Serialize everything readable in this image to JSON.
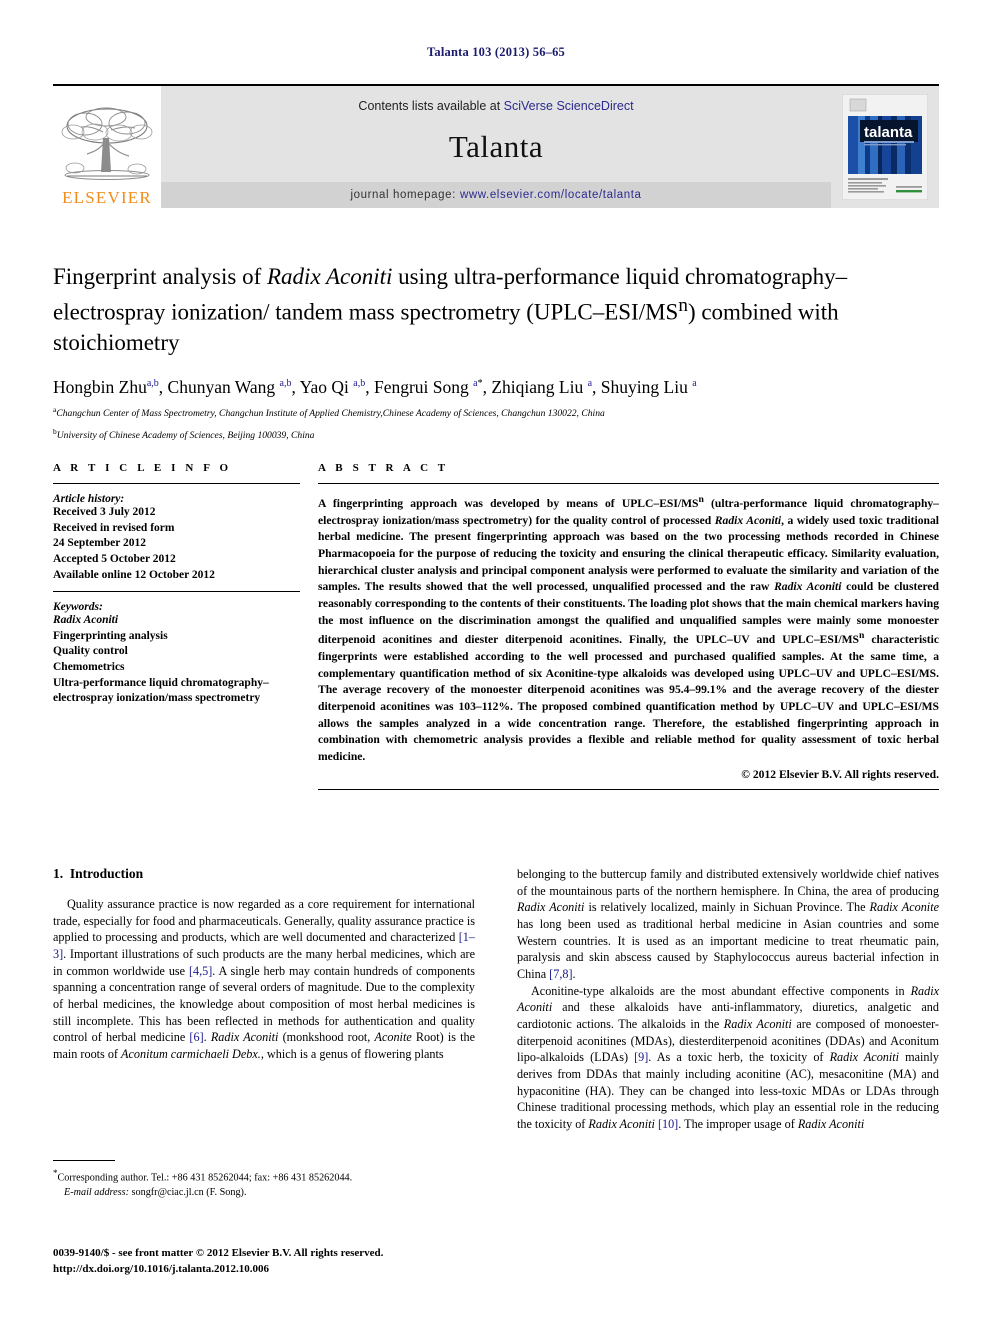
{
  "running_head": "Talanta 103 (2013) 56–65",
  "masthead": {
    "contents_prefix": "Contents lists available at ",
    "contents_link": "SciVerse ScienceDirect",
    "journal_name": "Talanta",
    "homepage_label": "journal homepage:",
    "homepage_link": "www.elsevier.com/locate/talanta",
    "publisher_logo_text": "ELSEVIER",
    "cover_title": "talanta",
    "cover_subtitle": "the international journal of pure and applied analytical chemistry",
    "link_color": "#2b2b8f",
    "brand_color": "#F08C1A",
    "band_color": "#e3e3e3"
  },
  "article": {
    "title_line1_a": "Fingerprint analysis of ",
    "title_line1_i": "Radix Aconiti",
    "title_line1_b": " using ultra-performance liquid",
    "title_line2": "chromatography–electrospray ionization/ tandem mass spectrometry",
    "title_line3_a": "(UPLC–ESI/MS",
    "title_line3_sup": "n",
    "title_line3_b": ") combined with stoichiometry",
    "authors": [
      {
        "name": "Hongbin Zhu",
        "sup": "a,b",
        "sep": ", "
      },
      {
        "name": "Chunyan Wang ",
        "sup": "a,b",
        "sep": ", "
      },
      {
        "name": "Yao Qi ",
        "sup": "a,b",
        "sep": ", "
      },
      {
        "name": "Fengrui Song ",
        "sup": "a",
        "star": "*",
        "sep": ", "
      },
      {
        "name": "Zhiqiang Liu ",
        "sup": "a",
        "sep": ", "
      },
      {
        "name": "Shuying Liu ",
        "sup": "a",
        "sep": ""
      }
    ],
    "affiliations": [
      {
        "marker": "a",
        "text": "Changchun Center of Mass Spectrometry, Changchun Institute of Applied Chemistry,Chinese Academy of Sciences, Changchun 130022, China"
      },
      {
        "marker": "b",
        "text": "University of Chinese Academy of Sciences, Beijing 100039, China"
      }
    ]
  },
  "article_info": {
    "heading": "A R T I C L E  I N F O",
    "history_title": "Article history:",
    "history_lines": [
      "Received 3 July 2012",
      "Received in revised form",
      "24 September 2012",
      "Accepted 5 October 2012",
      "Available online 12 October 2012"
    ],
    "keywords_title": "Keywords:",
    "keywords": [
      "Radix Aconiti",
      "Fingerprinting analysis",
      "Quality control",
      "Chemometrics",
      "Ultra-performance liquid chromatography–",
      "electrospray ionization/mass spectrometry"
    ]
  },
  "abstract": {
    "heading": "A B S T R A C T",
    "p1_a": "A fingerprinting approach was developed by means of UPLC–ESI/MS",
    "p1_sup": "n",
    "p1_b": " (ultra-performance liquid chromatography–electrospray ionization/mass spectrometry) for the quality control of processed ",
    "p1_i1": "Radix Aconiti",
    "p1_c": ", a widely used toxic traditional herbal medicine. The present fingerprinting approach was based on the two processing methods recorded in Chinese Pharmacopoeia for the purpose of reducing the toxicity and ensuring the clinical therapeutic efficacy. Similarity evaluation, hierarchical cluster analysis and principal component analysis were performed to evaluate the similarity and variation of the samples. The results showed that the well processed, unqualified processed and the raw ",
    "p1_i2": "Radix Aconiti",
    "p1_d": " could be clustered reasonably corresponding to the contents of their constituents. The loading plot shows that the main chemical markers having the most influence on the discrimination amongst the qualified and unqualified samples were mainly some monoester diterpenoid aconitines and diester diterpenoid aconitines. Finally, the UPLC–UV and UPLC–ESI/MS",
    "p1_sup2": "n",
    "p1_e": " characteristic fingerprints were established according to the well processed and purchased qualified samples. At the same time, a complementary quantification method of six Aconitine-type alkaloids was developed using UPLC–UV and UPLC–ESI/MS. The average recovery of the monoester diterpenoid aconitines was 95.4–99.1% and the average recovery of the diester diterpenoid aconitines was 103–112%. The proposed combined quantification method by UPLC–UV and UPLC–ESI/MS allows the samples analyzed in a wide concentration range. Therefore, the established fingerprinting approach in combination with chemometric analysis provides a flexible and reliable method for quality assessment of toxic herbal medicine.",
    "copyright": "© 2012 Elsevier B.V. All rights reserved."
  },
  "body": {
    "section_number": "1.",
    "section_title": "Introduction",
    "left_p1_a": "Quality assurance practice is now regarded as a core requirement for international trade, especially for food and pharmaceuticals. Generally, quality assurance practice is applied to processing and products, which are well documented and characterized ",
    "left_p1_ref1": "[1–3]",
    "left_p1_b": ". Important illustrations of such products are the many herbal medicines, which are in common worldwide use ",
    "left_p1_ref2": "[4,5]",
    "left_p1_c": ". A single herb may contain hundreds of components spanning a concentration range of several orders of magnitude. Due to the complexity of herbal medicines, the knowledge about composition of most herbal medicines is still incomplete. This has been reflected in methods for authentication and quality control of herbal medicine ",
    "left_p1_ref3": "[6]",
    "left_p1_d": ". ",
    "left_p1_i1": "Radix Aconiti",
    "left_p1_e": " (monkshood root, ",
    "left_p1_i2": "Aconite",
    "left_p1_f": " Root) is the main roots of ",
    "left_p1_i3": "Aconitum carmichaeli Debx.",
    "left_p1_g": ", which is a genus of flowering plants",
    "right_p1_a": "belonging to the buttercup family and distributed extensively worldwide chief natives of the mountainous parts of the northern hemisphere. In China, the area of producing ",
    "right_p1_i1": "Radix Aconiti",
    "right_p1_b": " is relatively localized, mainly in Sichuan Province. The ",
    "right_p1_i2": "Radix Aconite",
    "right_p1_c": " has long been used as traditional herbal medicine in Asian countries and some Western countries. It is used as an important medicine to treat rheumatic pain, paralysis and skin abscess caused by Staphylococcus aureus bacterial infection in China ",
    "right_p1_ref1": "[7,8]",
    "right_p1_d": ".",
    "right_p2_a": "Aconitine-type alkaloids are the most abundant effective components in ",
    "right_p2_i1": "Radix Aconiti",
    "right_p2_b": " and these alkaloids have anti-inflammatory, diuretics, analgetic and cardiotonic actions. The alkaloids in the ",
    "right_p2_i2": "Radix Aconiti",
    "right_p2_c": " are composed of monoester-diterpenoid aconitines (MDAs), diesterditerpenoid aconitines (DDAs) and Aconitum lipo-alkaloids (LDAs) ",
    "right_p2_ref1": "[9]",
    "right_p2_d": ". As a toxic herb, the toxicity of ",
    "right_p2_i3": "Radix Aconiti",
    "right_p2_e": " mainly derives from DDAs that mainly including aconitine (AC), mesaconitine (MA) and hypaconitine (HA). They can be changed into less-toxic MDAs or LDAs through Chinese traditional processing methods, which play an essential role in the reducing the toxicity of ",
    "right_p2_i4": "Radix Aconiti",
    "right_p2_ref2": " [10]",
    "right_p2_f": ". The improper usage of ",
    "right_p2_i5": "Radix Aconiti"
  },
  "footnote": {
    "star": "*",
    "corresponding": "Corresponding author. Tel.: +86 431 85262044; fax: +86 431 85262044.",
    "email_label": "E-mail address:",
    "email_value": " songfr@ciac.jl.cn (F. Song)."
  },
  "imprint": {
    "line1": "0039-9140/$ - see front matter © 2012 Elsevier B.V. All rights reserved.",
    "line2": "http://dx.doi.org/10.1016/j.talanta.2012.10.006"
  }
}
